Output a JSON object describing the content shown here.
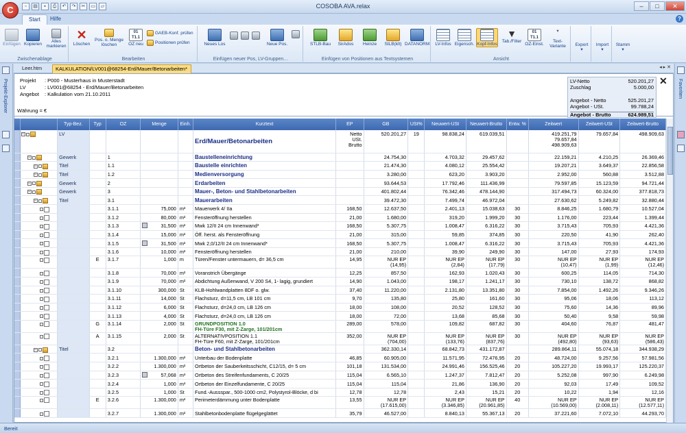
{
  "window": {
    "title": "COSOBA AVA.relax",
    "app_badge": "C"
  },
  "ribbon_tabs": [
    "Start",
    "Hilfe"
  ],
  "ribbon": {
    "zwischenablage": {
      "label": "Zwischenablage",
      "einfuegen": "Einfügen",
      "kopieren": "Kopieren",
      "alles_markieren": "Alles markieren"
    },
    "bearbeiten": {
      "label": "Bearbeiten",
      "loeschen": "Löschen",
      "pos_menge_loeschen": "Pos. o. Menge löschen",
      "oz_neu": "OZ neu",
      "gaeb_konf": "GAEB-Konf. prüfen",
      "positionen_pruefen": "Positionen prüfen"
    },
    "einfuegen_neuer": {
      "label": "Einfügen neuer Pos, LV-Gruppen…",
      "neues_los": "Neues Los",
      "neue_pos": "Neue Pos."
    },
    "textsysteme": {
      "label": "Einfügen von Positionen aus Textsystemen",
      "stlb_bau": "STLB-Bau",
      "sirados": "SirAdos",
      "heinze": "Heinze",
      "stlb_klt": "StLB(klt)",
      "datanorm": "DATANORM"
    },
    "ansicht": {
      "label": "Ansicht",
      "lv_infos": "LV-Infos",
      "eigensch": "Eigensch.",
      "kopf_infos": "Kopf-Infos",
      "tab_filter": "Tab./Filter",
      "oz_einst": "OZ-Einst.",
      "text_variante": "Text-Variante"
    },
    "export": "Export",
    "import": "Import",
    "stamm": "Stamm"
  },
  "side": {
    "left": "Projekt-Explorer",
    "right": "Favoriten"
  },
  "doc_tabs": {
    "first": "Leer.htm",
    "active": "KALKULATION/LV001@68254-Erd/Mauer/Betonarbeiten*"
  },
  "info": {
    "projekt_label": "Projekt",
    "projekt": ": P000 - Musterhaus in Musterstadt",
    "lv_label": "LV",
    "lv": ": LV001@68254 - Erd/Mauer/Betonarbeiten",
    "angebot_label": "Angebot",
    "angebot": ": Kalkulation vom 21.10.2011",
    "waehrung": "Währung = €"
  },
  "summary": [
    {
      "k": "LV-Netto",
      "v": "520.201,27"
    },
    {
      "k": "Zuschlag",
      "v": "5.000,00"
    },
    {
      "k": "",
      "v": ""
    },
    {
      "k": "Angebot - Netto",
      "v": "525.201,27"
    },
    {
      "k": "Angebot - USt.",
      "v": "99.788,24"
    },
    {
      "k": "Angebot - Brutto",
      "v": "624.989,51"
    }
  ],
  "columns": [
    "Typ-Bez.",
    "Typ",
    "OZ",
    "Menge",
    "Einh.",
    "Kurztext",
    "EP",
    "GB",
    "USt%",
    "Neuwert-USt",
    "Neuwert-Brutto",
    "Entw. %",
    "Zeitwert",
    "Zeitwert-USt",
    "Zeitwert-Brutto"
  ],
  "rows": [
    {
      "typbez": "LV",
      "typ": "",
      "oz": "",
      "menge": "",
      "einh": "",
      "kt": "Erd/Mauer/Betonarbeiten",
      "kt_style": "big",
      "ep": "Netto\nUSt.\nBrutto",
      "gb": "520.201,27",
      "ust": "19",
      "nu": "98.838,24",
      "nb": "619.039,51",
      "entw": "",
      "zw": "419.251,79\n79.657,84\n498.909,63",
      "zu": "79.657,84",
      "zb": "498.909,63",
      "kind": "big",
      "depth": 0
    },
    {
      "typbez": "Gewerk",
      "typ": "",
      "oz": "1",
      "menge": "",
      "einh": "",
      "kt": "Baustelleneinrichtung",
      "kt_style": "b",
      "ep": "",
      "gb": "24.754,30",
      "ust": "",
      "nu": "4.703,32",
      "nb": "29.457,62",
      "entw": "",
      "zw": "22.159,21",
      "zu": "4.210,25",
      "zb": "26.369,46",
      "depth": 1
    },
    {
      "typbez": "Titel",
      "typ": "",
      "oz": "1.1",
      "menge": "",
      "einh": "",
      "kt": "Baustelle einrichten",
      "kt_style": "b",
      "ep": "",
      "gb": "21.474,30",
      "ust": "",
      "nu": "4.080,12",
      "nb": "25.554,42",
      "entw": "",
      "zw": "19.207,21",
      "zu": "3.649,37",
      "zb": "22.856,58",
      "depth": 2
    },
    {
      "typbez": "Titel",
      "typ": "",
      "oz": "1.2",
      "menge": "",
      "einh": "",
      "kt": "Medienversorgung",
      "kt_style": "b",
      "ep": "",
      "gb": "3.280,00",
      "ust": "",
      "nu": "623,20",
      "nb": "3.903,20",
      "entw": "",
      "zw": "2.952,00",
      "zu": "560,88",
      "zb": "3.512,88",
      "depth": 2
    },
    {
      "typbez": "Gewerk",
      "typ": "",
      "oz": "2",
      "menge": "",
      "einh": "",
      "kt": "Erdarbeiten",
      "kt_style": "b",
      "ep": "",
      "gb": "93.644,53",
      "ust": "",
      "nu": "17.792,46",
      "nb": "111.436,99",
      "entw": "",
      "zw": "79.597,85",
      "zu": "15.123,59",
      "zb": "94.721,44",
      "depth": 1
    },
    {
      "typbez": "Gewerk",
      "typ": "",
      "oz": "3",
      "menge": "",
      "einh": "",
      "kt": "Mauer-, Beton- und Stahlbetonarbeiten",
      "kt_style": "b",
      "ep": "",
      "gb": "401.802,44",
      "ust": "",
      "nu": "76.342,46",
      "nb": "478.144,90",
      "entw": "",
      "zw": "317.494,73",
      "zu": "60.324,00",
      "zb": "377.818,73",
      "depth": 1
    },
    {
      "typbez": "Titel",
      "typ": "",
      "oz": "3.1",
      "menge": "",
      "einh": "",
      "kt": "Mauerarbeiten",
      "kt_style": "b",
      "ep": "",
      "gb": "39.472,30",
      "ust": "",
      "nu": "7.499,74",
      "nb": "46.972,04",
      "entw": "",
      "zw": "27.630,62",
      "zu": "5.249,82",
      "zb": "32.880,44",
      "depth": 2
    },
    {
      "typbez": "",
      "typ": "",
      "oz": "3.1.1",
      "menge": "75,000",
      "einh": "m²",
      "kt": "Mauerwerk 4/ IIa",
      "ep": "168,50",
      "gb": "12.637,50",
      "ust": "",
      "nu": "2.401,13",
      "nb": "15.038,63",
      "entw": "30",
      "zw": "8.846,25",
      "zu": "1.680,79",
      "zb": "10.527,04",
      "depth": 3
    },
    {
      "typbez": "",
      "typ": "",
      "oz": "3.1.2",
      "menge": "80,000",
      "einh": "m²",
      "kt": "Fensteröffnung herstellen",
      "ep": "21,00",
      "gb": "1.680,00",
      "ust": "",
      "nu": "319,20",
      "nb": "1.999,20",
      "entw": "30",
      "zw": "1.176,00",
      "zu": "223,44",
      "zb": "1.399,44",
      "depth": 3
    },
    {
      "typbez": "",
      "typ": "",
      "oz": "3.1.3",
      "menge": "31,500",
      "einh": "m²",
      "kt": "Mwk 12/II 24 cm Innenwand*",
      "ep": "168,50",
      "gb": "5.307,75",
      "ust": "",
      "nu": "1.008,47",
      "nb": "6.316,22",
      "entw": "30",
      "zw": "3.715,43",
      "zu": "705,93",
      "zb": "4.421,36",
      "depth": 3,
      "sheet": true
    },
    {
      "typbez": "",
      "typ": "",
      "oz": "3.1.4",
      "menge": "15,000",
      "einh": "m²",
      "kt": "Öff. herst. als Fensteröffnung",
      "ep": "21,00",
      "gb": "315,00",
      "ust": "",
      "nu": "59,85",
      "nb": "374,85",
      "entw": "30",
      "zw": "220,50",
      "zu": "41,90",
      "zb": "262,40",
      "depth": 3
    },
    {
      "typbez": "",
      "typ": "",
      "oz": "3.1.5",
      "menge": "31,500",
      "einh": "m²",
      "kt": "Mwk 2,0/12/II 24 cm Innenwand*",
      "ep": "168,50",
      "gb": "5.307,75",
      "ust": "",
      "nu": "1.008,47",
      "nb": "6.316,22",
      "entw": "30",
      "zw": "3.715,43",
      "zu": "705,93",
      "zb": "4.421,36",
      "depth": 3,
      "sheet": true
    },
    {
      "typbez": "",
      "typ": "",
      "oz": "3.1.6",
      "menge": "10,000",
      "einh": "m²",
      "kt": "Fensteröffnung herstellen",
      "ep": "21,00",
      "gb": "210,00",
      "ust": "",
      "nu": "39,90",
      "nb": "249,90",
      "entw": "30",
      "zw": "147,00",
      "zu": "27,93",
      "zb": "174,93",
      "depth": 3
    },
    {
      "typbez": "",
      "typ": "E",
      "oz": "3.1.7",
      "menge": "1,000",
      "einh": "m",
      "kt": "Türen/Fenster untermauern, d= 36,5 cm",
      "ep": "14,95",
      "gb": "NUR EP\n(14,95)",
      "ust": "",
      "nu": "NUR EP\n(2,84)",
      "nb": "NUR EP\n(17,79)",
      "entw": "30",
      "zw": "NUR EP\n(10,47)",
      "zu": "NUR EP\n(1,99)",
      "zb": "NUR EP\n(12,46)",
      "depth": 3,
      "kind": "tall"
    },
    {
      "typbez": "",
      "typ": "",
      "oz": "3.1.8",
      "menge": "70,000",
      "einh": "m²",
      "kt": "Voranstrich Übergänge",
      "ep": "12,25",
      "gb": "857,50",
      "ust": "",
      "nu": "162,93",
      "nb": "1.020,43",
      "entw": "30",
      "zw": "600,25",
      "zu": "114,05",
      "zb": "714,30",
      "depth": 3
    },
    {
      "typbez": "",
      "typ": "",
      "oz": "3.1.9",
      "menge": "70,000",
      "einh": "m²",
      "kt": "Abdichtung Außenwand, V 200 S4, 1- lagig, grundiert",
      "ep": "14,90",
      "gb": "1.043,00",
      "ust": "",
      "nu": "198,17",
      "nb": "1.241,17",
      "entw": "30",
      "zw": "730,10",
      "zu": "138,72",
      "zb": "868,82",
      "depth": 3
    },
    {
      "typbez": "",
      "typ": "",
      "oz": "3.1.10",
      "menge": "300,000",
      "einh": "St",
      "kt": "KLB-Hohlwandplatten 8DF o. glw.",
      "ep": "37,40",
      "gb": "11.220,00",
      "ust": "",
      "nu": "2.131,80",
      "nb": "13.351,80",
      "entw": "30",
      "zw": "7.854,00",
      "zu": "1.492,26",
      "zb": "9.346,26",
      "depth": 3
    },
    {
      "typbez": "",
      "typ": "",
      "oz": "3.1.11",
      "menge": "14,000",
      "einh": "St",
      "kt": "Flachsturz, d=11,5 cm, LB 101 cm",
      "ep": "9,70",
      "gb": "135,80",
      "ust": "",
      "nu": "25,80",
      "nb": "161,60",
      "entw": "30",
      "zw": "95,06",
      "zu": "18,06",
      "zb": "113,12",
      "depth": 3
    },
    {
      "typbez": "",
      "typ": "",
      "oz": "3.1.12",
      "menge": "6,000",
      "einh": "St",
      "kt": "Flachsturz, d=24,0 cm, LB 126 cm",
      "ep": "18,00",
      "gb": "108,00",
      "ust": "",
      "nu": "20,52",
      "nb": "128,52",
      "entw": "30",
      "zw": "75,60",
      "zu": "14,36",
      "zb": "89,96",
      "depth": 3
    },
    {
      "typbez": "",
      "typ": "",
      "oz": "3.1.13",
      "menge": "4,000",
      "einh": "St",
      "kt": "Flachsturz, d=24,0 cm, LB 126 cm",
      "ep": "18,00",
      "gb": "72,00",
      "ust": "",
      "nu": "13,68",
      "nb": "85,68",
      "entw": "30",
      "zw": "50,40",
      "zu": "9,58",
      "zb": "59,98",
      "depth": 3
    },
    {
      "typbez": "",
      "typ": "G",
      "oz": "3.1.14",
      "menge": "2,000",
      "einh": "St",
      "kt": "GRUNDPOSITION 1.0\nFH-Türe F30, mit Z-Zarge, 101/201cm",
      "kt_style": "green",
      "ep": "289,00",
      "gb": "578,00",
      "ust": "",
      "nu": "109,82",
      "nb": "687,82",
      "entw": "30",
      "zw": "404,60",
      "zu": "76,87",
      "zb": "481,47",
      "depth": 3,
      "kind": "tall"
    },
    {
      "typbez": "",
      "typ": "A",
      "oz": "3.1.15",
      "menge": "2,000",
      "einh": "St",
      "kt": "ALTERNATIVPOSITION 1.1\nFH-Türe F60, mit Z-Zarge, 101/201cm",
      "ep": "352,00",
      "gb": "NUR EP\n(704,00)",
      "ust": "",
      "nu": "NUR EP\n(133,76)",
      "nb": "NUR EP\n(837,76)",
      "entw": "30",
      "zw": "NUR EP\n(492,80)",
      "zu": "NUR EP\n(93,63)",
      "zb": "NUR EP\n(586,43)",
      "depth": 3,
      "kind": "tall"
    },
    {
      "typbez": "Titel",
      "typ": "",
      "oz": "3.2",
      "menge": "",
      "einh": "",
      "kt": "Beton- und Stahlbetonarbeiten",
      "kt_style": "b",
      "ep": "",
      "gb": "362.330,14",
      "ust": "",
      "nu": "68.842,73",
      "nb": "431.172,87",
      "entw": "",
      "zw": "289.864,11",
      "zu": "55.074,18",
      "zb": "344.938,29",
      "depth": 2
    },
    {
      "typbez": "",
      "typ": "",
      "oz": "3.2.1",
      "menge": "1.300,000",
      "einh": "m²",
      "kt": "Unterbau der Bodenplatte",
      "ep": "46,85",
      "gb": "60.905,00",
      "ust": "",
      "nu": "11.571,95",
      "nb": "72.476,95",
      "entw": "20",
      "zw": "48.724,00",
      "zu": "9.257,56",
      "zb": "57.981,56",
      "depth": 3
    },
    {
      "typbez": "",
      "typ": "",
      "oz": "3.2.2",
      "menge": "1.300,000",
      "einh": "m²",
      "kt": "Ortbeton der Sauberkeitsschicht, C12/15, d= 5 cm",
      "ep": "101,18",
      "gb": "131.534,00",
      "ust": "",
      "nu": "24.991,46",
      "nb": "156.525,46",
      "entw": "20",
      "zw": "105.227,20",
      "zu": "19.993,17",
      "zb": "125.220,37",
      "depth": 3
    },
    {
      "typbez": "",
      "typ": "",
      "oz": "3.2.3",
      "menge": "57,068",
      "einh": "m³",
      "kt": "Ortbeton des Streifenfundaments, C 20/25",
      "ep": "115,04",
      "gb": "6.565,10",
      "ust": "",
      "nu": "1.247,37",
      "nb": "7.812,47",
      "entw": "20",
      "zw": "5.252,08",
      "zu": "997,90",
      "zb": "6.249,98",
      "depth": 3,
      "sheet": true
    },
    {
      "typbez": "",
      "typ": "",
      "oz": "3.2.4",
      "menge": "1,000",
      "einh": "m³",
      "kt": "Ortbeton der Einzelfundamente, C 20/25",
      "ep": "115,04",
      "gb": "115,04",
      "ust": "",
      "nu": "21,86",
      "nb": "136,90",
      "entw": "20",
      "zw": "92,03",
      "zu": "17,49",
      "zb": "109,52",
      "depth": 3
    },
    {
      "typbez": "",
      "typ": "",
      "oz": "3.2.5",
      "menge": "1,000",
      "einh": "St",
      "kt": "Fund.-Aussspar., 500-1000 cm2, Polystyrol-Blöcke, d bi",
      "ep": "12,78",
      "gb": "12,78",
      "ust": "",
      "nu": "2,43",
      "nb": "15,21",
      "entw": "20",
      "zw": "10,22",
      "zu": "1,94",
      "zb": "12,16",
      "depth": 3
    },
    {
      "typbez": "",
      "typ": "E",
      "oz": "3.2.6",
      "menge": "1.300,000",
      "einh": "m²",
      "kt": "Perimeterdämmung unter Bodenplatte",
      "ep": "13,55",
      "gb": "NUR EP\n(17.615,00)",
      "ust": "",
      "nu": "NUR EP\n(3.346,85)",
      "nb": "NUR EP\n(20.961,85)",
      "entw": "40",
      "zw": "NUR EP\n(10.569,00)",
      "zu": "NUR EP\n(2.008,11)",
      "zb": "NUR EP\n(12.577,11)",
      "depth": 3,
      "kind": "tall"
    },
    {
      "typbez": "",
      "typ": "",
      "oz": "3.2.7",
      "menge": "1.300,000",
      "einh": "m²",
      "kt": "Stahlbetonbodenplatte flügelgeglättet",
      "ep": "35,79",
      "gb": "46.527,00",
      "ust": "",
      "nu": "8.840,13",
      "nb": "55.367,13",
      "entw": "20",
      "zw": "37.221,60",
      "zu": "7.072,10",
      "zb": "44.293,70",
      "depth": 3
    }
  ],
  "status": "Bereit"
}
